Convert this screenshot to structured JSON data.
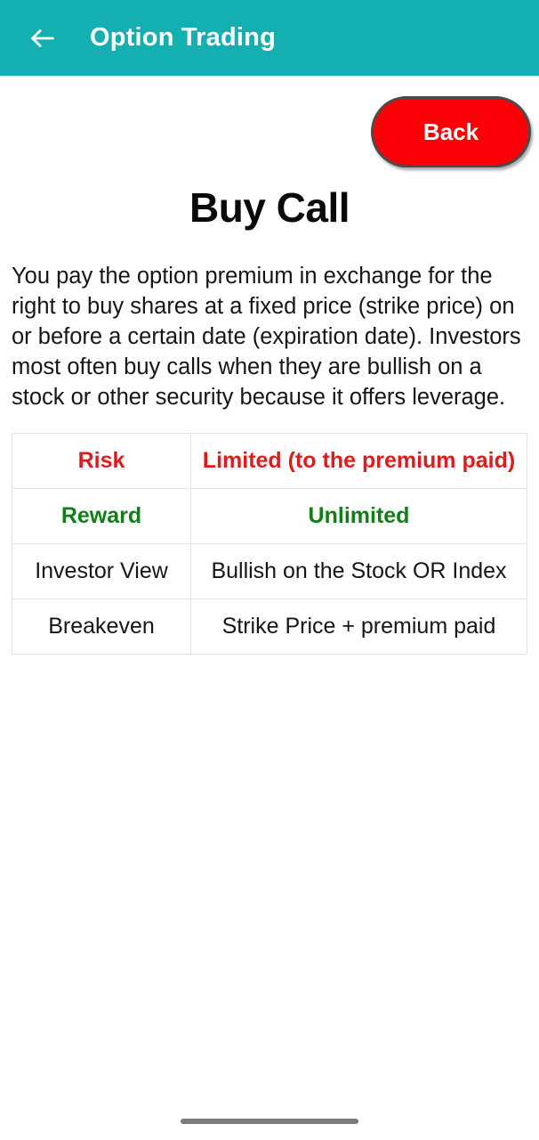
{
  "appbar": {
    "back_icon": "arrow-left-icon",
    "title": "Option Trading"
  },
  "actions": {
    "back_button_label": "Back"
  },
  "main": {
    "page_title": "Buy Call",
    "description": "You pay the option premium in exchange for the right to buy shares at a fixed price (strike price) on or before a certain date (expiration date). Investors most often buy calls when they are bullish on a stock or other security because it offers leverage."
  },
  "table": {
    "rows": [
      {
        "label": "Risk",
        "value": "Limited (to the premium paid)"
      },
      {
        "label": "Reward",
        "value": "Unlimited"
      },
      {
        "label": "Investor View",
        "value": "Bullish on the Stock OR Index"
      },
      {
        "label": "Breakeven",
        "value": "Strike Price + premium paid"
      }
    ]
  },
  "colors": {
    "appbar_teal": "#14AFB0",
    "back_button_red": "#FB0007",
    "risk_red": "#DE1C1C",
    "reward_green": "#0E8017",
    "table_border": "#e3e3e3"
  }
}
